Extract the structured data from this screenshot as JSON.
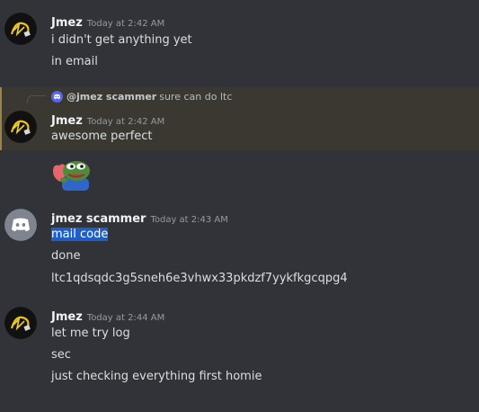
{
  "messages": {
    "m1": {
      "username": "Jmez",
      "timestamp": "Today at 2:42 AM",
      "lines": [
        "i didn't get anything yet",
        "in email"
      ]
    },
    "m2": {
      "reply": {
        "username": "@jmez scammer",
        "text": "sure can do ltc"
      },
      "username": "Jmez",
      "timestamp": "Today at 2:42 AM",
      "lines": [
        "awesome perfect"
      ],
      "sticker": "pepe-hug-heart-icon"
    },
    "m3": {
      "username": "jmez scammer",
      "timestamp": "Today at 2:43 AM",
      "lines": [
        "mail code",
        "done",
        "ltc1qdsqdc3g5sneh6e3vhwx33pkdzf7yykfkgcqpg4"
      ]
    },
    "m4": {
      "username": "Jmez",
      "timestamp": "Today at 2:44 AM",
      "lines": [
        "let me try log",
        "sec",
        "just checking everything first homie"
      ]
    }
  },
  "colors": {
    "background": "#313338",
    "reply_highlight": "#3a3830",
    "discord_blurple": "#5865f2",
    "selection": "#1e5fc7"
  }
}
